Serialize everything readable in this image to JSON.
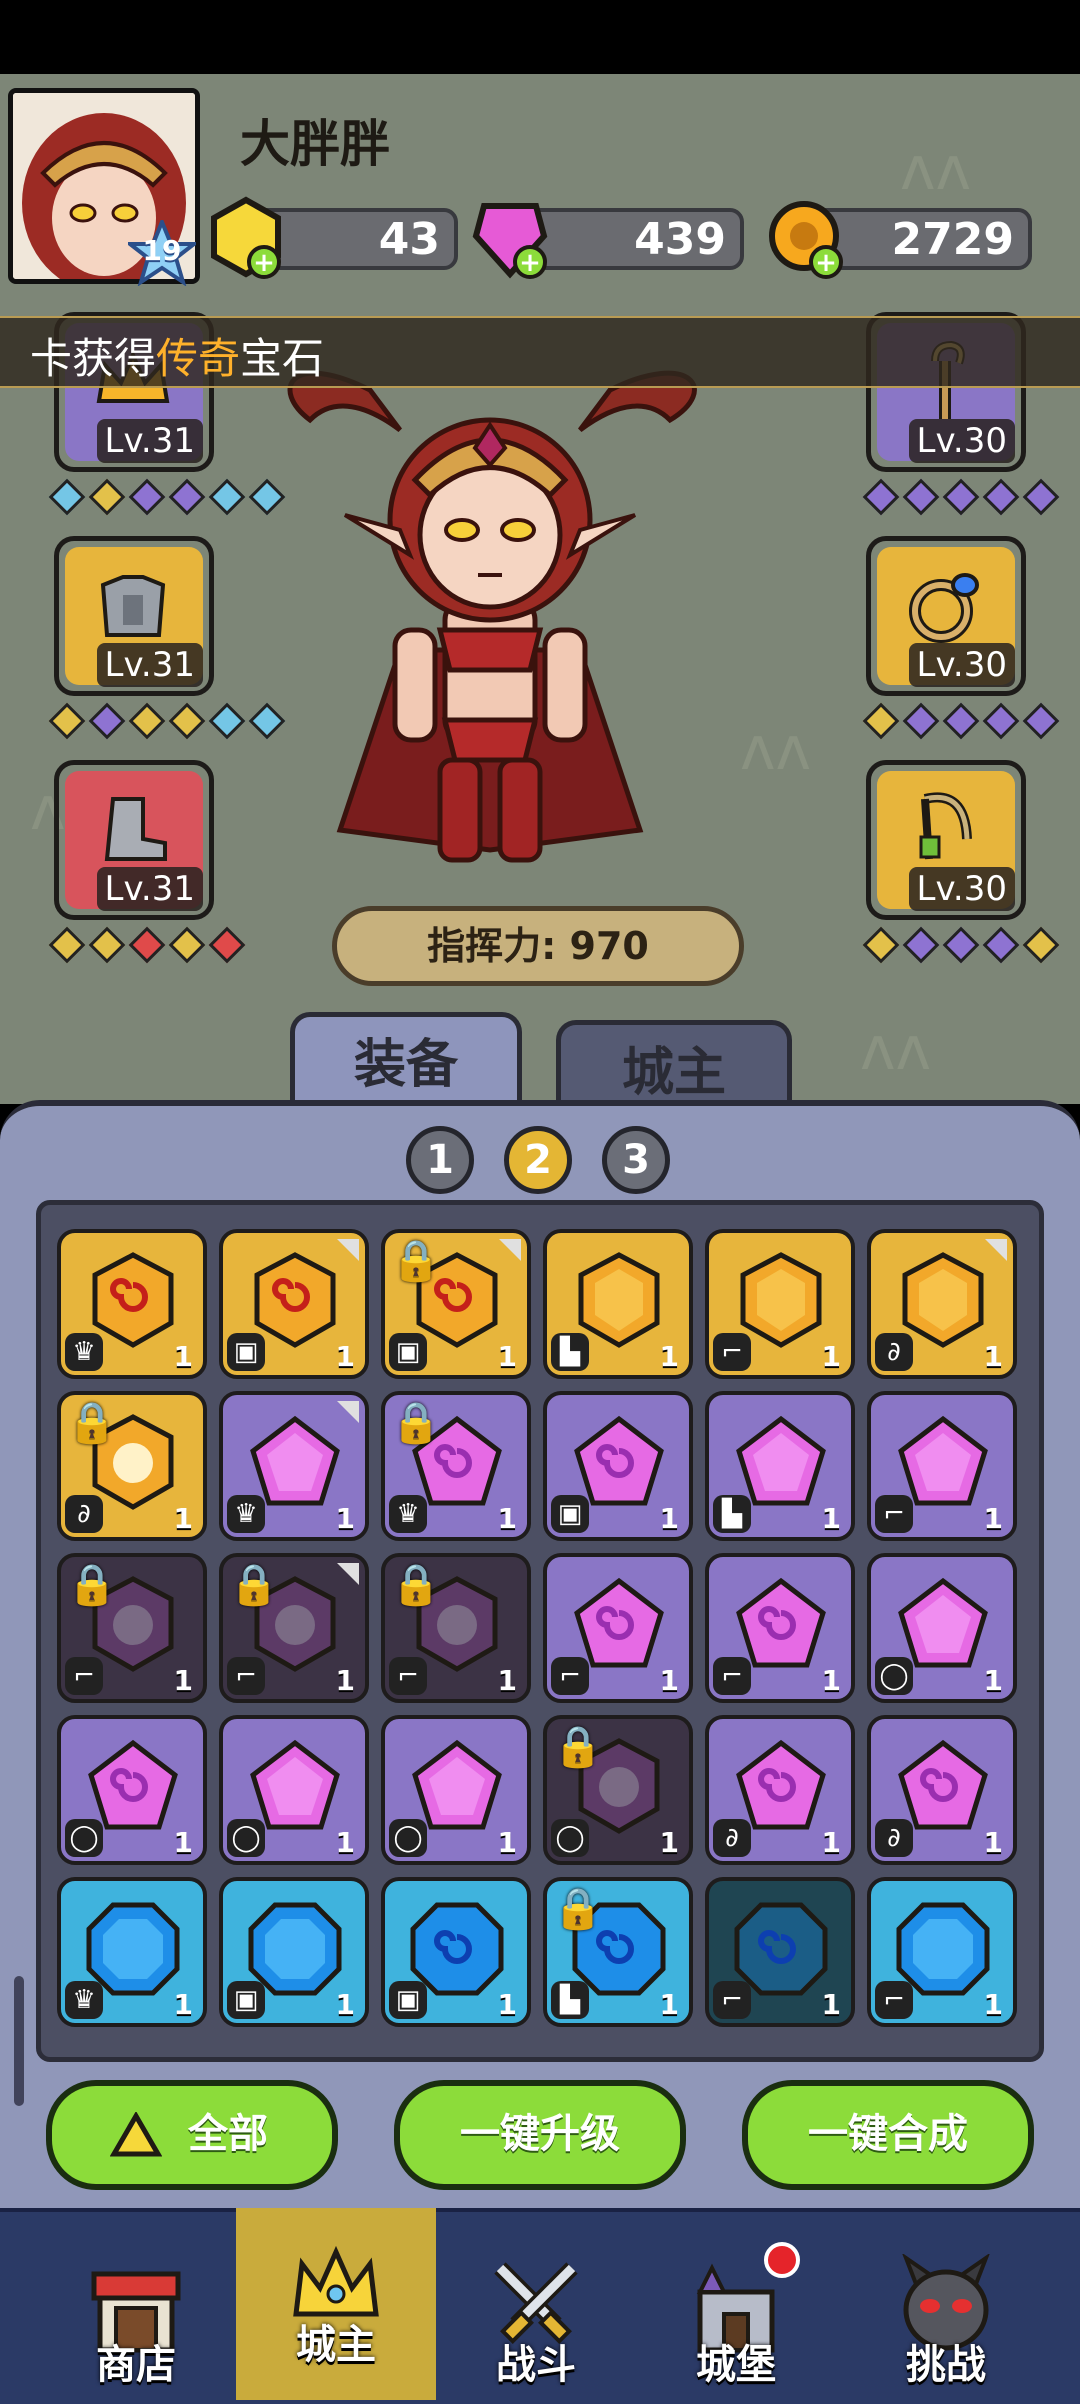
{
  "player": {
    "name": "大胖胖",
    "level": "19"
  },
  "resources": [
    {
      "name": "gold-gem",
      "value": "43"
    },
    {
      "name": "pink-gem",
      "value": "439"
    },
    {
      "name": "coin",
      "value": "2729"
    }
  ],
  "banner": {
    "prefix": "卡获得",
    "highlight": "传奇",
    "suffix": "宝石"
  },
  "equipment": {
    "left": [
      {
        "icon": "crown-icon",
        "level": "Lv.31",
        "color": "#8a76c6"
      },
      {
        "icon": "armor-icon",
        "level": "Lv.31",
        "color": "#e7b53c"
      },
      {
        "icon": "boot-icon",
        "level": "Lv.31",
        "color": "#d8545c"
      }
    ],
    "right": [
      {
        "icon": "staff-icon",
        "level": "Lv.30",
        "color": "#8a76c6"
      },
      {
        "icon": "ring-icon",
        "level": "Lv.30",
        "color": "#e7b53c"
      },
      {
        "icon": "amulet-icon",
        "level": "Lv.30",
        "color": "#e7b53c"
      }
    ]
  },
  "power": {
    "label": "指挥力: 970"
  },
  "tabs": [
    {
      "label": "装备",
      "active": true
    },
    {
      "label": "城主",
      "active": false
    }
  ],
  "pages": [
    {
      "label": "1"
    },
    {
      "label": "2",
      "active": true
    },
    {
      "label": "3"
    }
  ],
  "gems": [
    [
      {
        "rarity": "gold",
        "shape": "hex",
        "slot": "crown",
        "count": "1"
      },
      {
        "rarity": "gold",
        "shape": "hex",
        "slot": "armor",
        "count": "1",
        "corner": true
      },
      {
        "rarity": "gold",
        "shape": "hex",
        "slot": "armor",
        "count": "1",
        "locked": true,
        "corner": true
      },
      {
        "rarity": "gold",
        "shape": "hexplain",
        "slot": "boot",
        "count": "1"
      },
      {
        "rarity": "gold",
        "shape": "hexplain",
        "slot": "staff",
        "count": "1"
      },
      {
        "rarity": "gold",
        "shape": "hexplain",
        "slot": "amulet",
        "count": "1",
        "corner": true
      }
    ],
    [
      {
        "rarity": "gold",
        "shape": "burst",
        "slot": "amulet",
        "count": "1",
        "locked": true
      },
      {
        "rarity": "purple",
        "shape": "pent",
        "slot": "crown",
        "count": "1",
        "corner": true
      },
      {
        "rarity": "purple",
        "shape": "pentswirl",
        "slot": "crown",
        "count": "1",
        "locked": true
      },
      {
        "rarity": "purple",
        "shape": "pentswirl",
        "slot": "armor",
        "count": "1"
      },
      {
        "rarity": "purple",
        "shape": "pent",
        "slot": "boot",
        "count": "1"
      },
      {
        "rarity": "purple",
        "shape": "pent",
        "slot": "staff",
        "count": "1"
      }
    ],
    [
      {
        "rarity": "dark",
        "shape": "burst",
        "slot": "staff",
        "count": "1",
        "locked": true
      },
      {
        "rarity": "dark",
        "shape": "burst",
        "slot": "staff",
        "count": "1",
        "locked": true,
        "corner": true
      },
      {
        "rarity": "dark",
        "shape": "burst",
        "slot": "staff",
        "count": "1",
        "locked": true
      },
      {
        "rarity": "purple",
        "shape": "pentswirl",
        "slot": "staff",
        "count": "1"
      },
      {
        "rarity": "purple",
        "shape": "pentswirl",
        "slot": "staff",
        "count": "1"
      },
      {
        "rarity": "purple",
        "shape": "pent",
        "slot": "ring",
        "count": "1"
      }
    ],
    [
      {
        "rarity": "purple",
        "shape": "pentswirl",
        "slot": "ring",
        "count": "1"
      },
      {
        "rarity": "purple",
        "shape": "pent",
        "slot": "ring",
        "count": "1"
      },
      {
        "rarity": "purple",
        "shape": "pent",
        "slot": "ring",
        "count": "1"
      },
      {
        "rarity": "dark",
        "shape": "burst",
        "slot": "ring",
        "count": "1",
        "locked": true
      },
      {
        "rarity": "purple",
        "shape": "pentswirl",
        "slot": "amulet",
        "count": "1"
      },
      {
        "rarity": "purple",
        "shape": "pentswirl",
        "slot": "amulet",
        "count": "1"
      }
    ],
    [
      {
        "rarity": "blue",
        "shape": "oct",
        "slot": "crown",
        "count": "1"
      },
      {
        "rarity": "blue",
        "shape": "oct",
        "slot": "armor",
        "count": "1"
      },
      {
        "rarity": "blue",
        "shape": "octswirl",
        "slot": "armor",
        "count": "1"
      },
      {
        "rarity": "blue",
        "shape": "octswirl",
        "slot": "boot",
        "count": "1",
        "locked": true
      },
      {
        "rarity": "darkblue",
        "shape": "octswirl",
        "slot": "staff",
        "count": "1"
      },
      {
        "rarity": "blue",
        "shape": "oct",
        "slot": "staff",
        "count": "1"
      }
    ]
  ],
  "actions": [
    {
      "label": "全部",
      "icon": "triangle-icon"
    },
    {
      "label": "一键升级"
    },
    {
      "label": "一键合成"
    }
  ],
  "nav": [
    {
      "label": "商店",
      "icon": "shop-icon"
    },
    {
      "label": "城主",
      "icon": "crown-icon",
      "active": true
    },
    {
      "label": "战斗",
      "icon": "swords-icon"
    },
    {
      "label": "城堡",
      "icon": "castle-icon",
      "badge": true
    },
    {
      "label": "挑战",
      "icon": "demon-icon"
    }
  ],
  "colors": {
    "gold": "#e7b53c",
    "purple": "#8a76c6",
    "blue": "#3fb3dd",
    "dark": "#3c3345",
    "darkblue": "#1f4552",
    "green": "#8cdc3a"
  }
}
